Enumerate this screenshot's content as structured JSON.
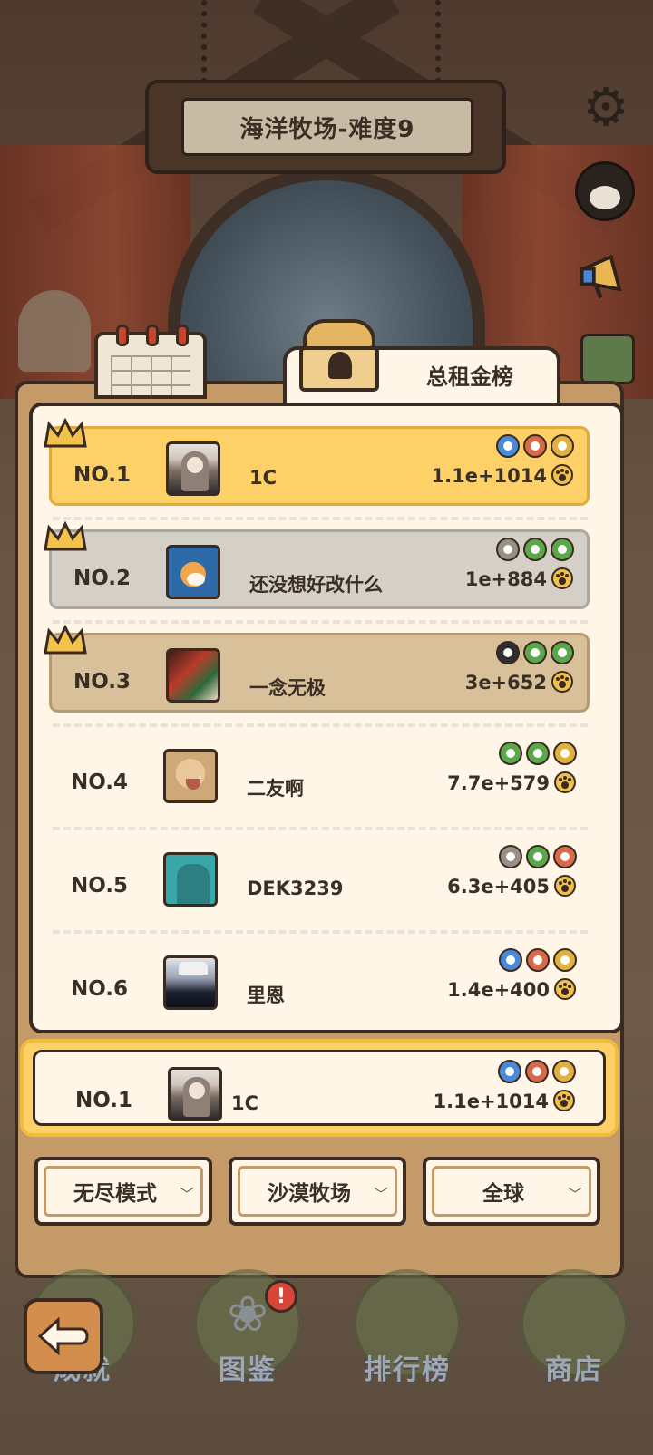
{
  "title": "海洋牧场-难度9",
  "tab_label": "总租金榜",
  "colors": {
    "gold": "#fdd167",
    "silver": "#d4d0c8",
    "bronze": "#d8c19a",
    "panel": "#c49a69",
    "paper": "#fff6e8"
  },
  "ranking": [
    {
      "rank": "NO.1",
      "name": "1C",
      "score": "1.1e+1014",
      "tier": "gold",
      "avatar": "girl-avatar",
      "badges": [
        "#4a88d8",
        "#d86a4a",
        "#e0b040"
      ]
    },
    {
      "rank": "NO.2",
      "name": "还没想好改什么",
      "score": "1e+884",
      "tier": "silver",
      "avatar": "shiba-avatar",
      "badges": [
        "#9a8e86",
        "#5aa84a",
        "#5aa84a"
      ]
    },
    {
      "rank": "NO.3",
      "name": "一念无极",
      "score": "3e+652",
      "tier": "bronze",
      "avatar": "anime-avatar",
      "badges": [
        "#2e2e2e",
        "#5aa84a",
        "#5aa84a"
      ]
    },
    {
      "rank": "NO.4",
      "name": "二友啊",
      "score": "7.7e+579",
      "tier": "plain",
      "avatar": "cat-avatar",
      "badges": [
        "#5aa84a",
        "#5aa84a",
        "#e0b040"
      ]
    },
    {
      "rank": "NO.5",
      "name": "DEK3239",
      "score": "6.3e+405",
      "tier": "plain",
      "avatar": "silhouette-avatar",
      "badges": [
        "#9a8e86",
        "#5aa84a",
        "#d86a4a"
      ]
    },
    {
      "rank": "NO.6",
      "name": "里恩",
      "score": "1.4e+400",
      "tier": "plain",
      "avatar": "dark-avatar",
      "badges": [
        "#4a88d8",
        "#d86a4a",
        "#e0b040"
      ]
    }
  ],
  "self_entry": {
    "rank": "NO.1",
    "name": "1C",
    "score": "1.1e+1014",
    "badges": [
      "#4a88d8",
      "#d86a4a",
      "#e0b040"
    ]
  },
  "filters": {
    "mode": "无尽模式",
    "map": "沙漠牧场",
    "region": "全球"
  },
  "bottom_nav": [
    {
      "label": "成就",
      "icon": "trophy-icon"
    },
    {
      "label": "图鉴",
      "icon": "paw-book-icon"
    },
    {
      "label": "排行榜",
      "icon": "scroll-icon"
    },
    {
      "label": "商店",
      "icon": "shop-icon"
    }
  ],
  "alert": "!"
}
